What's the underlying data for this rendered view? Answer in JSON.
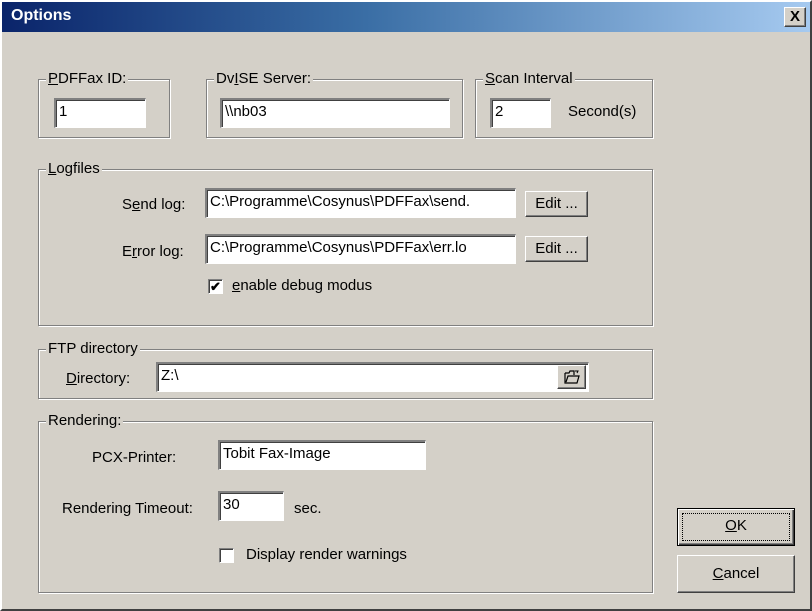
{
  "window": {
    "title": "Options",
    "close_glyph": "X"
  },
  "pdffax_id": {
    "label_u": "P",
    "label_rest": "DFFax ID:",
    "value": "1"
  },
  "dvise_server": {
    "label_pre": "Dv",
    "label_u": "I",
    "label_rest": "SE Server:",
    "value": "\\\\nb03"
  },
  "scan_interval": {
    "label_u": "S",
    "label_rest": "can Interval",
    "value": "2",
    "unit": "Second(s)"
  },
  "logfiles": {
    "legend_u": "L",
    "legend_rest": "ogfiles",
    "send_log": {
      "label_pre": "S",
      "label_u": "e",
      "label_rest": "nd log:",
      "value": "C:\\Programme\\Cosynus\\PDFFax\\send.",
      "edit_label": "Edit ..."
    },
    "error_log": {
      "label_pre": "E",
      "label_u": "r",
      "label_rest": "ror log:",
      "value": "C:\\Programme\\Cosynus\\PDFFax\\err.lo",
      "edit_label": "Edit ..."
    },
    "debug": {
      "checked": true,
      "label_u": "e",
      "label_rest": "nable debug modus"
    }
  },
  "ftp": {
    "legend": "FTP directory",
    "dir_label_u": "D",
    "dir_label_rest": "irectory:",
    "dir_value": "Z:\\",
    "browse_icon": "folder-open-icon"
  },
  "rendering": {
    "legend": "Rendering:",
    "printer_label": "PCX-Printer:",
    "printer_value": "Tobit Fax-Image",
    "timeout_label": "Rendering Timeout:",
    "timeout_value": "30",
    "timeout_unit": "sec.",
    "warnings": {
      "checked": false,
      "label": "Display render warnings"
    }
  },
  "buttons": {
    "ok_u": "O",
    "ok_rest": "K",
    "cancel_u": "C",
    "cancel_rest": "ancel"
  },
  "colors": {
    "face": "#d4d0c8",
    "title_start": "#0a246a",
    "title_end": "#a6caf0"
  }
}
